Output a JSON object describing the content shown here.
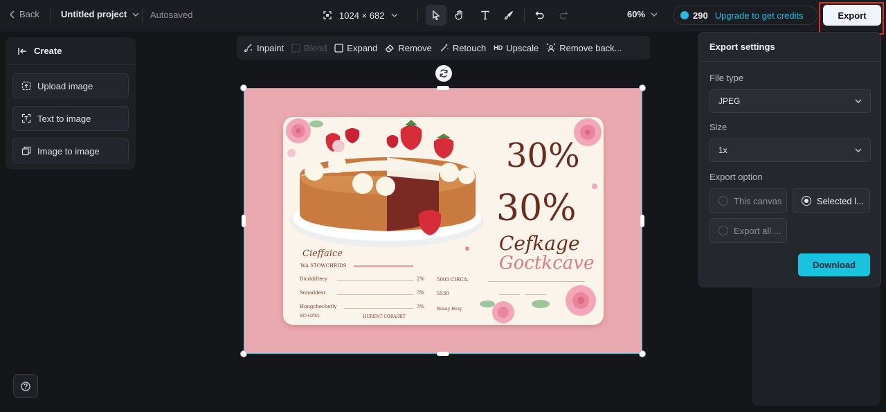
{
  "topbar": {
    "back_label": "Back",
    "project_title": "Untitled project",
    "autosave_status": "Autosaved",
    "canvas_size": "1024 × 682",
    "zoom": "60%",
    "credits": "290",
    "upgrade_label": "Upgrade to get credits",
    "export_label": "Export",
    "tools": [
      "pointer-icon",
      "hand-icon",
      "text-icon",
      "brush-icon",
      "undo-icon",
      "redo-icon"
    ]
  },
  "left_panel": {
    "create_label": "Create",
    "items": [
      {
        "label": "Upload image",
        "icon": "upload-image-icon"
      },
      {
        "label": "Text to image",
        "icon": "text-to-image-icon"
      },
      {
        "label": "Image to image",
        "icon": "image-to-image-icon"
      }
    ]
  },
  "edit_toolbar": {
    "items": [
      {
        "label": "Inpaint",
        "icon": "inpaint-icon",
        "enabled": true
      },
      {
        "label": "Blend",
        "icon": "blend-icon",
        "enabled": false
      },
      {
        "label": "Expand",
        "icon": "expand-icon",
        "enabled": true
      },
      {
        "label": "Remove",
        "icon": "eraser-icon",
        "enabled": true
      },
      {
        "label": "Retouch",
        "icon": "retouch-icon",
        "enabled": true
      },
      {
        "label": "Upscale",
        "icon": "HD",
        "enabled": true
      },
      {
        "label": "Remove back...",
        "icon": "remove-background-icon",
        "enabled": true
      }
    ]
  },
  "canvas_image": {
    "headline_1": "30%",
    "headline_2": "30%",
    "script_1": "Cefkage",
    "script_2": "Goctkcave",
    "script_left": "Cieffaice",
    "subtitle": "WA STOWCHRIDS",
    "rows_left": [
      {
        "label": "Dicddiftery",
        "value": "2%"
      },
      {
        "label": "Sonaddesr",
        "value": "3%"
      },
      {
        "label": "Hongchechetly",
        "value": "3%"
      }
    ],
    "foot_left": "9I5·GPX5",
    "foot_mid": "HURENT COBAIRIT",
    "rows_right": [
      "5003 CIRCA.",
      "5530",
      "Bonny Hezy"
    ],
    "colors": {
      "background": "#e9a9ae",
      "card": "#fbf4ea",
      "text": "#6b2c1c",
      "script_pink": "#d97a8a"
    }
  },
  "export_settings": {
    "title": "Export settings",
    "file_type_label": "File type",
    "file_type_value": "JPEG",
    "size_label": "Size",
    "size_value": "1x",
    "option_label": "Export option",
    "options": [
      {
        "label": "This canvas",
        "selected": false
      },
      {
        "label": "Selected l...",
        "selected": true
      },
      {
        "label": "Export all ...",
        "selected": false
      }
    ],
    "download_label": "Download"
  },
  "colors": {
    "accent": "#18c3e0",
    "highlight_box": "#e0302a",
    "background": "#14161a"
  }
}
